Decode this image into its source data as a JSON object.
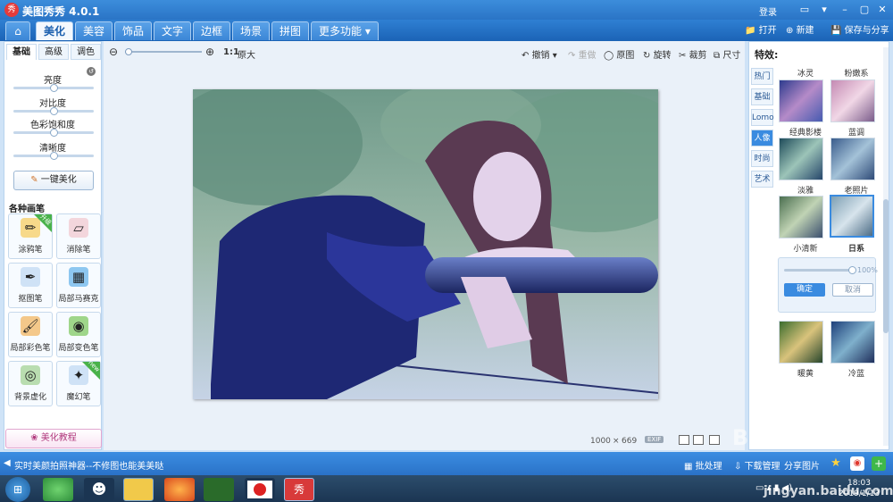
{
  "titlebar": {
    "app_title": "美图秀秀 4.0.1",
    "login": "登录"
  },
  "menu": {
    "home_icon": "home-icon",
    "tabs": [
      "美化",
      "美容",
      "饰品",
      "文字",
      "边框",
      "场景",
      "拼图"
    ],
    "more": "更多功能",
    "open": "打开",
    "new": "新建",
    "save_share": "保存与分享"
  },
  "left": {
    "subtabs": [
      "基础",
      "高级",
      "调色"
    ],
    "sliders": [
      {
        "label": "亮度",
        "value": 0.5
      },
      {
        "label": "对比度",
        "value": 0.5
      },
      {
        "label": "色彩饱和度",
        "value": 0.5
      },
      {
        "label": "清晰度",
        "value": 0.5
      }
    ],
    "one_click": "一键美化",
    "brushes_title": "各种画笔",
    "brushes": [
      {
        "label": "涂鸦笔",
        "icon": "pencil-icon",
        "badge": "升级"
      },
      {
        "label": "消除笔",
        "icon": "eraser-icon",
        "badge": ""
      },
      {
        "label": "抠图笔",
        "icon": "pen-nib-icon",
        "badge": ""
      },
      {
        "label": "局部马赛克",
        "icon": "mosaic-icon",
        "badge": ""
      },
      {
        "label": "局部彩色笔",
        "icon": "color-brush-icon",
        "badge": ""
      },
      {
        "label": "局部变色笔",
        "icon": "paint-bucket-icon",
        "badge": ""
      },
      {
        "label": "背景虚化",
        "icon": "blur-icon",
        "badge": ""
      },
      {
        "label": "魔幻笔",
        "icon": "magic-pen-icon",
        "badge": "new"
      }
    ],
    "tutorial": "美化教程"
  },
  "toolbar": {
    "zoom_ratio": "1:1",
    "zoom_original": "原大",
    "undo": "撤销",
    "redo": "重做",
    "original": "原图",
    "rotate": "旋转",
    "crop": "裁剪",
    "size": "尺寸"
  },
  "canvas": {
    "width_value": "1000",
    "times": "×",
    "height_value": "669",
    "exif": "EXIF"
  },
  "right": {
    "title": "特效:",
    "categories": [
      "热门",
      "基础",
      "Lomo",
      "人像",
      "时尚",
      "艺术"
    ],
    "active_category": "人像",
    "effects": [
      {
        "label": "冰灵"
      },
      {
        "label": "粉嫩系"
      },
      {
        "label": "经典影楼"
      },
      {
        "label": "蓝调"
      },
      {
        "label": "淡雅"
      },
      {
        "label": "老照片"
      },
      {
        "label": "小清新"
      },
      {
        "label": "日系"
      },
      {
        "label": "暖黄"
      },
      {
        "label": "冷蓝"
      }
    ],
    "selected_effect": "日系",
    "intensity": "100%",
    "intensity_value": 1.0,
    "confirm": "确定",
    "cancel": "取消"
  },
  "status": {
    "message": "实时美颜拍照神器--不修图也能美美哒",
    "batch": "批处理",
    "download": "下载管理",
    "share": "分享图片"
  },
  "taskbar": {
    "time": "18:03",
    "date": "2019/1/13"
  },
  "watermark": {
    "site": "jingyan.baidu.com",
    "brand": "Baidu经验"
  },
  "colors": {
    "accent": "#2a74c6",
    "selected": "#3a8be0",
    "badge_green": "#49b24a"
  }
}
